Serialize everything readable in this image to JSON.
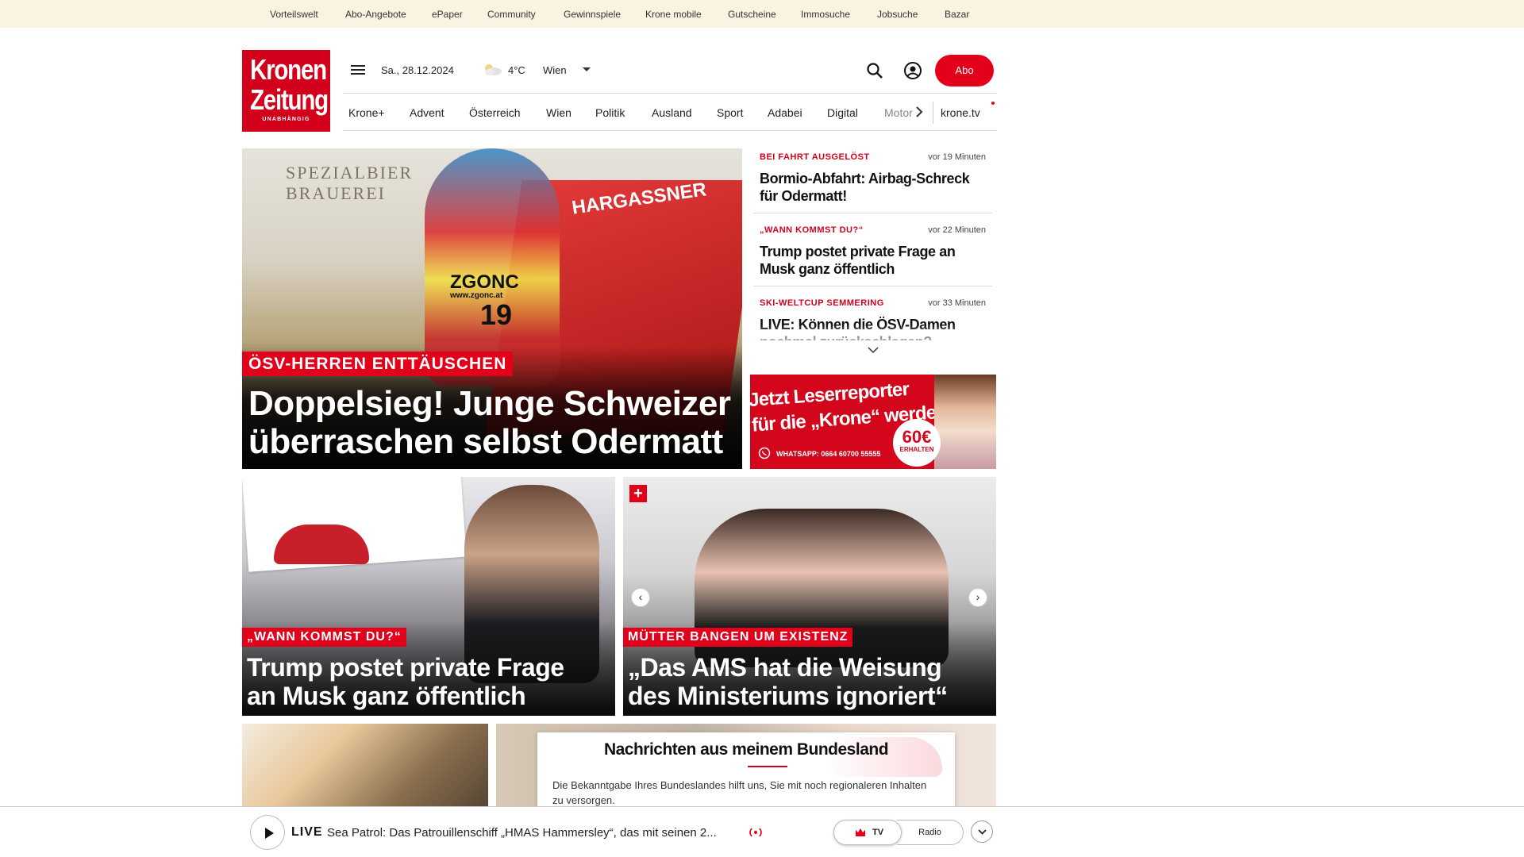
{
  "topbar": {
    "links": [
      "Vorteilswelt",
      "Abo-Angebote",
      "ePaper",
      "Community",
      "Gewinnspiele",
      "Krone mobile",
      "Gutscheine",
      "Immosuche",
      "Jobsuche",
      "Bazar"
    ]
  },
  "logo": {
    "line1": "Kronen",
    "line2": "Zeitung",
    "line3": "UNABHÄNGIG"
  },
  "header": {
    "date": "Sa., 28.12.2024",
    "temperature": "4°C",
    "city": "Wien",
    "abo_label": "Abo",
    "icons": [
      "menu-icon",
      "weather-icon",
      "chevron-down-icon",
      "search-icon",
      "user-icon"
    ]
  },
  "nav": {
    "items": [
      "Krone+",
      "Advent",
      "Österreich",
      "Wien",
      "Politik",
      "Ausland",
      "Sport",
      "Adabei",
      "Digital",
      "Motor"
    ],
    "krone_tv": "krone.tv"
  },
  "hero": {
    "kicker": "ÖSV-HERREN ENTTÄUSCHEN",
    "headline_1": "Doppelsieg! Junge Schweizer",
    "headline_2": "überraschen selbst Odermatt",
    "bib": "19",
    "sponsor": "ZGONC",
    "sponsor_url": "www.zgonc.at",
    "banner_left": "SPEZIALBIER BRAUEREI",
    "banner_right": "HARGASSNER"
  },
  "sidebar": {
    "items": [
      {
        "kicker": "BEI FAHRT AUSGELÖST",
        "time": "vor 19 Minuten",
        "headline": "Bormio-Abfahrt: Airbag-Schreck für Odermatt!"
      },
      {
        "kicker": "„WANN KOMMST DU?“",
        "time": "vor 22 Minuten",
        "headline": "Trump postet private Frage an Musk ganz öffentlich"
      },
      {
        "kicker": "SKI-WELTCUP SEMMERING",
        "time": "vor 33 Minuten",
        "headline": "LIVE: Können die ÖSV-Damen nochmal zurückschlagen?"
      }
    ]
  },
  "promo": {
    "line1": "Jetzt Leserreporter",
    "line2": "für die „Krone“ werden",
    "whatsapp": "WHATSAPP: 0664 60700 55555",
    "amount": "60€",
    "erhalten": "ERHALTEN"
  },
  "cards": [
    {
      "kicker": "„WANN KOMMST DU?“",
      "headline_1": "Trump postet private Frage",
      "headline_2": "an Musk ganz öffentlich"
    },
    {
      "kicker": "MÜTTER BANGEN UM EXISTENZ",
      "headline_1": "„Das AMS hat die Weisung",
      "headline_2": "des Ministeriums ignoriert“"
    }
  ],
  "bundesland": {
    "title": "Nachrichten aus meinem Bundesland",
    "text": "Die Bekanntgabe Ihres Bundeslandes hilft uns, Sie mit noch regionaleren Inhalten zu versorgen."
  },
  "player": {
    "live": "LIVE",
    "title": "Sea Patrol: Das Patrouillenschiff „HMAS Hammersley“, das mit seinen 2...",
    "tv_label": "TV",
    "radio_label": "Radio"
  },
  "colors": {
    "brand_red": "#e2001a",
    "topbar_bg": "#fbf3e2"
  }
}
